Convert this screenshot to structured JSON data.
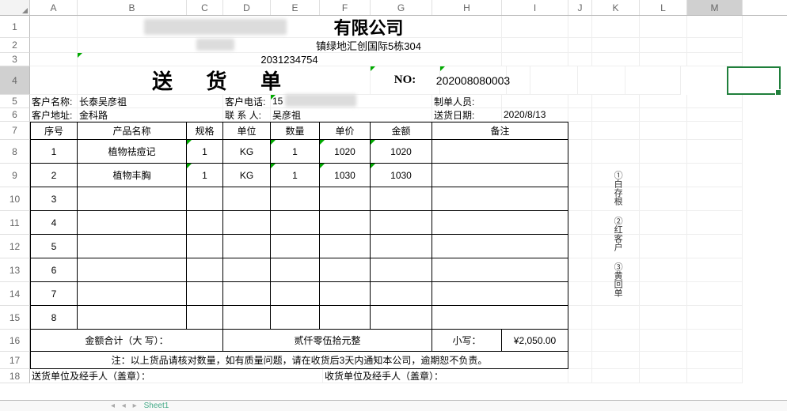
{
  "cols": [
    "A",
    "B",
    "C",
    "D",
    "E",
    "F",
    "G",
    "H",
    "I",
    "J",
    "K",
    "L",
    "M"
  ],
  "company_suffix": "有限公司",
  "address_suffix": "镇绿地汇创国际5栋304",
  "phone_line": "2031234754",
  "doc_title": "送 货 单",
  "no_label": "NO:",
  "no_value": "202008080003",
  "fields": {
    "cust_name_label": "客户名称:",
    "cust_name_value": "长泰吴彦祖",
    "cust_phone_label": "客户电话:",
    "cust_phone_value": "15",
    "maker_label": "制单人员:",
    "maker_value": "",
    "cust_addr_label": "客户地址:",
    "cust_addr_value": "金科路",
    "contact_label": "联 系 人:",
    "contact_value": "吴彦祖",
    "ship_date_label": "送货日期:",
    "ship_date_value": "2020/8/13"
  },
  "head": {
    "seq": "序号",
    "name": "产品名称",
    "spec": "规格",
    "unit": "单位",
    "qty": "数量",
    "price": "单价",
    "amount": "金额",
    "remark": "备注"
  },
  "rows": [
    {
      "seq": "1",
      "name": "植物祛痘记",
      "spec": "1",
      "unit": "KG",
      "qty": "1",
      "price": "1020",
      "amount": "1020"
    },
    {
      "seq": "2",
      "name": "植物丰胸",
      "spec": "1",
      "unit": "KG",
      "qty": "1",
      "price": "1030",
      "amount": "1030"
    },
    {
      "seq": "3",
      "name": "",
      "spec": "",
      "unit": "",
      "qty": "",
      "price": "",
      "amount": ""
    },
    {
      "seq": "4",
      "name": "",
      "spec": "",
      "unit": "",
      "qty": "",
      "price": "",
      "amount": ""
    },
    {
      "seq": "5",
      "name": "",
      "spec": "",
      "unit": "",
      "qty": "",
      "price": "",
      "amount": ""
    },
    {
      "seq": "6",
      "name": "",
      "spec": "",
      "unit": "",
      "qty": "",
      "price": "",
      "amount": ""
    },
    {
      "seq": "7",
      "name": "",
      "spec": "",
      "unit": "",
      "qty": "",
      "price": "",
      "amount": ""
    },
    {
      "seq": "8",
      "name": "",
      "spec": "",
      "unit": "",
      "qty": "",
      "price": "",
      "amount": ""
    }
  ],
  "total_label": "金额合计（大 写）：",
  "total_cn": "贰仟零伍拾元整",
  "small_label": "小写：",
  "small_value": "¥2,050.00",
  "note": "注：以上货品请核对数量，如有质量问题，请在收货后3天内通知本公司，逾期恕不负责。",
  "sender": "送货单位及经手人（盖章）：",
  "receiver": "收货单位及经手人（盖章）：",
  "side": [
    "①白存根",
    "②红客户",
    "③黄回单"
  ],
  "sheet_tab": "Sheet1"
}
